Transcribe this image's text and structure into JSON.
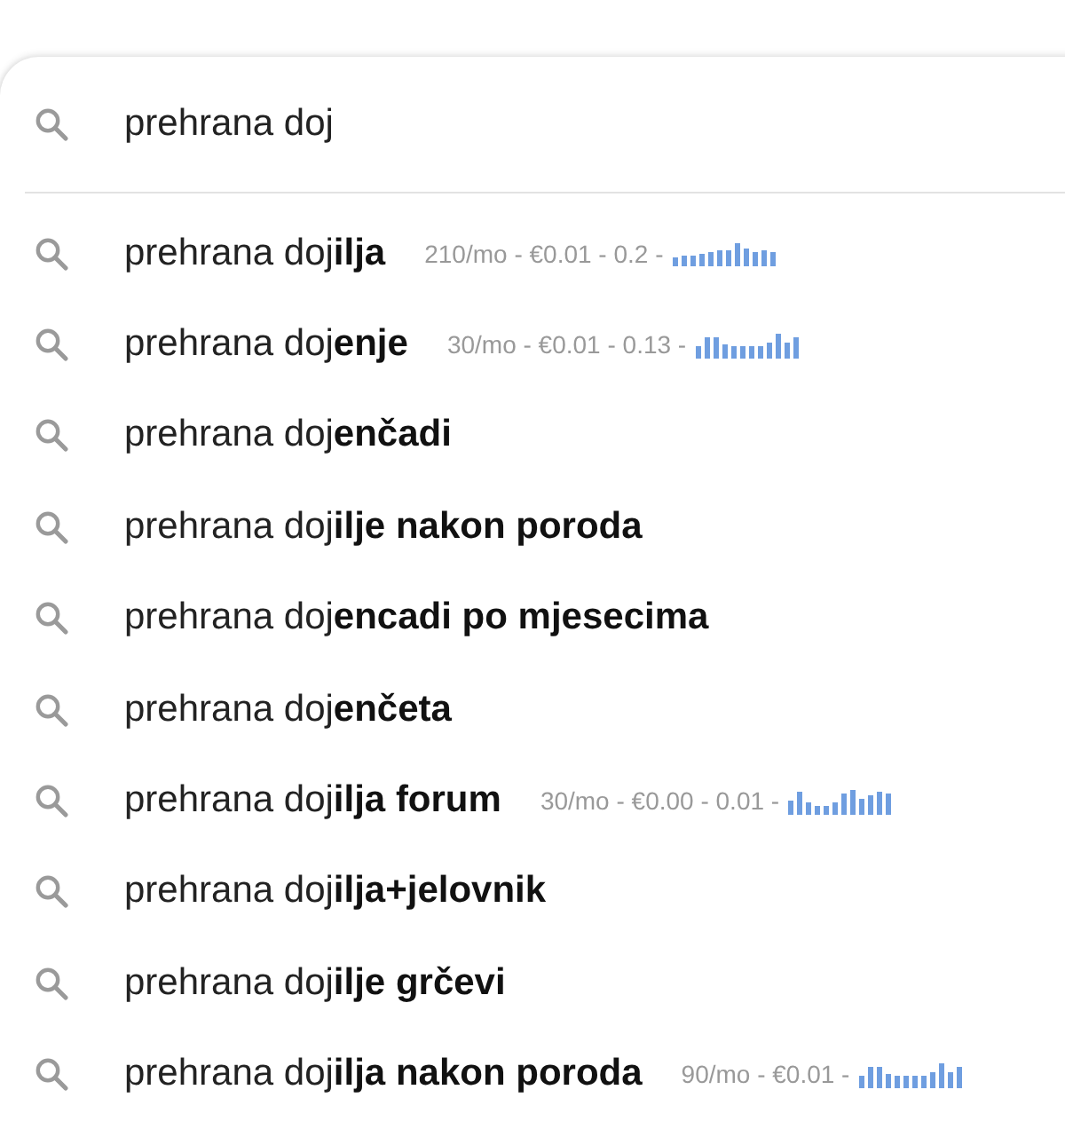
{
  "search": {
    "value": "prehrana doj"
  },
  "suggestions": [
    {
      "text": "prehrana doj**ilja**",
      "metrics": "210/mo - €0.01 - 0.2 -"
    },
    {
      "text": "prehrana doj**enje**",
      "metrics": "30/mo - €0.01 - 0.13 -"
    },
    {
      "text": "prehrana doj**enčadi**"
    },
    {
      "text": "prehrana doj**ilje nakon poroda**"
    },
    {
      "text": "prehrana doj**encadi po mjesecima**"
    },
    {
      "text": "prehrana doj**enčeta**"
    },
    {
      "text": "prehrana doj**ilja forum**",
      "metrics": "30/mo - €0.00 - 0.01 -"
    },
    {
      "text": "prehrana doj**ilja+jelovnik**"
    },
    {
      "text": "prehrana doj**ilje grčevi**"
    },
    {
      "text": "prehrana doj**ilja nakon poroda**",
      "metrics": "90/mo - €0.01 -"
    }
  ]
}
